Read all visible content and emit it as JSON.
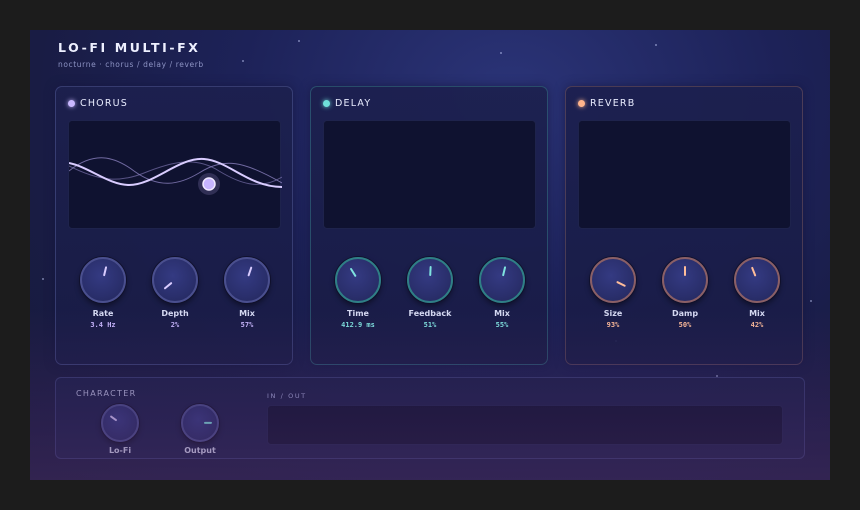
{
  "header": {
    "title": "LO-FI MULTI-FX",
    "subtitle": "nocturne · chorus / delay / reverb"
  },
  "colors": {
    "chorus_accent": "#c9b8ff",
    "delay_accent": "#6fe0da",
    "reverb_accent": "#ffb48c",
    "background": "#1d2258"
  },
  "panels": {
    "chorus": {
      "title": "CHORUS",
      "knobs": [
        {
          "label": "Rate",
          "value": "3.4 Hz",
          "level": 0.55
        },
        {
          "label": "Depth",
          "value": "2%",
          "level": 0.02
        },
        {
          "label": "Mix",
          "value": "57%",
          "level": 0.57
        }
      ]
    },
    "delay": {
      "title": "DELAY",
      "knobs": [
        {
          "label": "Time",
          "value": "412.9 ms",
          "level": 0.38
        },
        {
          "label": "Feedback",
          "value": "51%",
          "level": 0.51
        },
        {
          "label": "Mix",
          "value": "55%",
          "level": 0.55
        }
      ]
    },
    "reverb": {
      "title": "REVERB",
      "knobs": [
        {
          "label": "Size",
          "value": "93%",
          "level": 0.93
        },
        {
          "label": "Damp",
          "value": "50%",
          "level": 0.5
        },
        {
          "label": "Mix",
          "value": "42%",
          "level": 0.42
        }
      ]
    }
  },
  "character": {
    "title": "CHARACTER",
    "knobs": [
      {
        "label": "Lo-Fi",
        "level": 0.3
      },
      {
        "label": "Output",
        "level": 0.83
      }
    ],
    "meter_label": "IN / OUT"
  }
}
